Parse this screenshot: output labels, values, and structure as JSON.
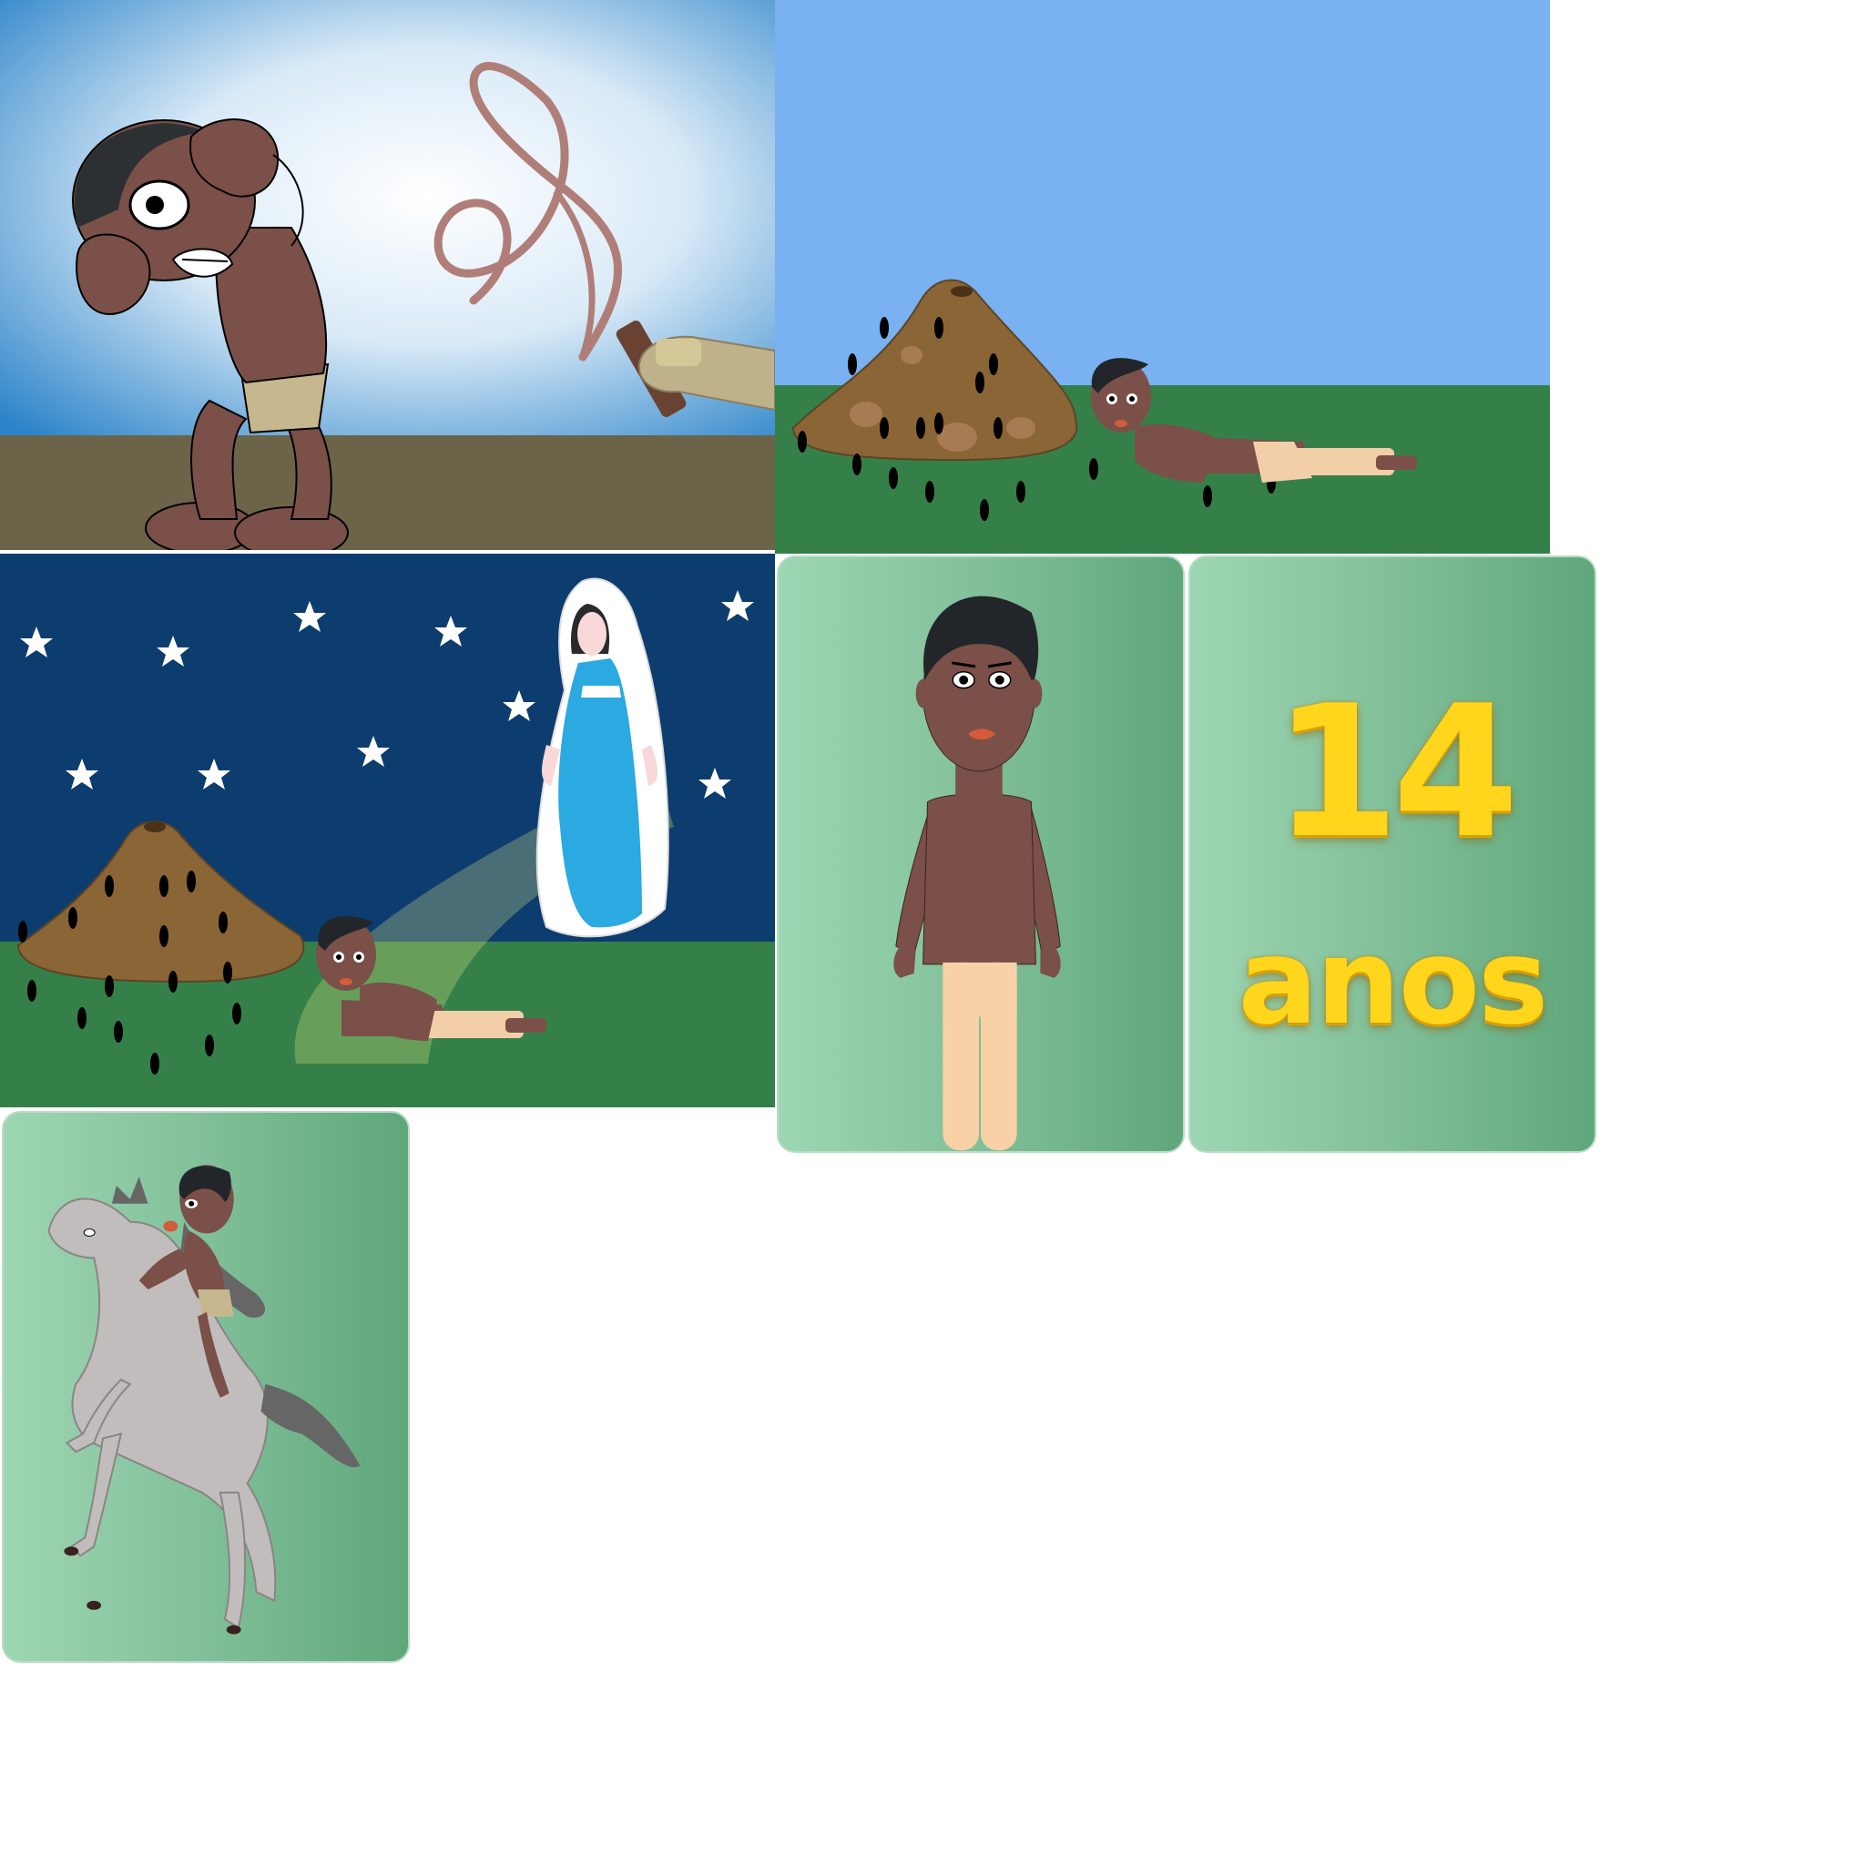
{
  "panels": [
    {
      "id": "whipping-scene"
    },
    {
      "id": "anthill-scene"
    },
    {
      "id": "night-vision-scene"
    },
    {
      "id": "young-man-portrait"
    },
    {
      "id": "age-card"
    },
    {
      "id": "horse-ride-scene"
    }
  ],
  "age_card": {
    "number": "14",
    "unit": "anos"
  },
  "colors": {
    "skin": "#7a5048",
    "sky_day": "#79b1f1",
    "grass": "#358049",
    "night_sky": "#0d3c6e",
    "card_green": "#84c29c",
    "age_yellow": "#ffd61c",
    "robe_blue": "#2ba9e1"
  }
}
